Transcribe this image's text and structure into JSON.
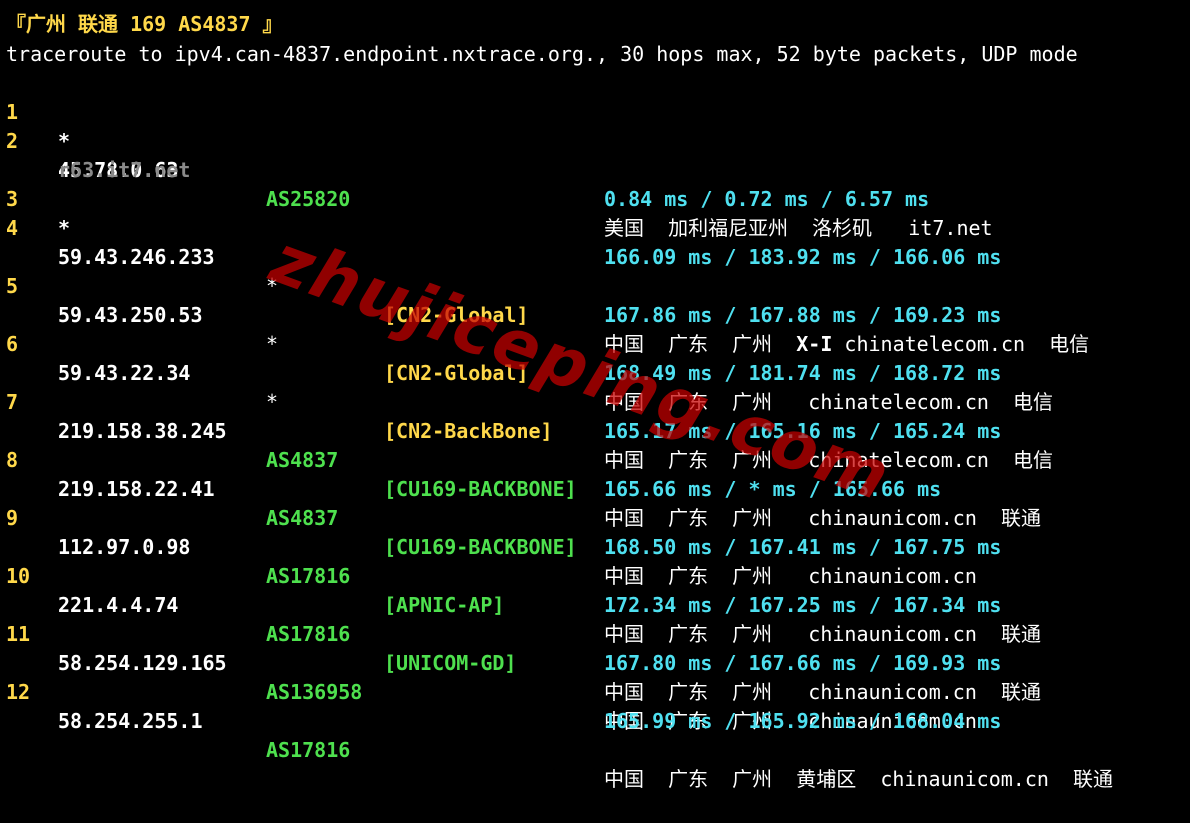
{
  "title": "『广州 联通 169 AS4837 』",
  "header": "traceroute to ipv4.can-4837.endpoint.nxtrace.org., 30 hops max, 52 byte packets, UDP mode",
  "watermark": "zhujiceping.com",
  "colors": {
    "background": "#000000",
    "hop_number": "#ffd84a",
    "asn": "#4ee04e",
    "rtt": "#4fe0f0",
    "rdns": "#8a8a8a",
    "watermark": "#c80000"
  },
  "hops": [
    {
      "n": "1",
      "ip": "*"
    },
    {
      "n": "2",
      "ip": "45.78.0.63",
      "asn": "AS25820",
      "tag": "",
      "geo": "美国  加利福尼亚州  洛杉矶   it7.net",
      "rdns": "r63.it7.net",
      "rtt": "0.84 ms / 0.72 ms / 6.57 ms"
    },
    {
      "n": "3",
      "ip": "*"
    },
    {
      "n": "4",
      "ip": "59.43.246.233",
      "asn": "*",
      "tag": "[CN2-Global]",
      "geo": "中国  广东  广州  ",
      "geo_bold": "X-I",
      "geo_tail": " chinatelecom.cn  电信",
      "rtt": "166.09 ms / 183.92 ms / 166.06 ms"
    },
    {
      "n": "5",
      "ip": "59.43.250.53",
      "asn": "*",
      "tag": "[CN2-Global]",
      "geo": "中国  广东  广州   chinatelecom.cn  电信",
      "rtt": "167.86 ms / 167.88 ms / 169.23 ms"
    },
    {
      "n": "6",
      "ip": "59.43.22.34",
      "asn": "*",
      "tag": "[CN2-BackBone]",
      "geo": "中国  广东  广州   chinatelecom.cn  电信",
      "rtt": "168.49 ms / 181.74 ms / 168.72 ms"
    },
    {
      "n": "7",
      "ip": "219.158.38.245",
      "asn": "AS4837",
      "tag": "[CU169-BACKBONE]",
      "geo": "中国  广东  广州   chinaunicom.cn  联通",
      "rtt": "165.17 ms / 165.16 ms / 165.24 ms"
    },
    {
      "n": "8",
      "ip": "219.158.22.41",
      "asn": "AS4837",
      "tag": "[CU169-BACKBONE]",
      "geo": "中国  广东  广州   chinaunicom.cn",
      "rtt": "165.66 ms / * ms / 165.66 ms"
    },
    {
      "n": "9",
      "ip": "112.97.0.98",
      "asn": "AS17816",
      "tag": "[APNIC-AP]",
      "geo": "中国  广东  广州   chinaunicom.cn  联通",
      "rtt": "168.50 ms / 167.41 ms / 167.75 ms"
    },
    {
      "n": "10",
      "ip": "221.4.4.74",
      "asn": "AS17816",
      "tag": "[UNICOM-GD]",
      "geo": "中国  广东  广州   chinaunicom.cn  联通",
      "rtt": "172.34 ms / 167.25 ms / 167.34 ms"
    },
    {
      "n": "11",
      "ip": "58.254.129.165",
      "asn": "AS136958",
      "tag": "",
      "geo": "中国  广东  广州   chinaunicom.cn",
      "rtt": "167.80 ms / 167.66 ms / 169.93 ms"
    },
    {
      "n": "12",
      "ip": "58.254.255.1",
      "asn": "AS17816",
      "tag": "",
      "geo": "中国  广东  广州  黄埔区  chinaunicom.cn  联通",
      "rtt": "165.99 ms / 165.92 ms / 168.04 ms"
    }
  ]
}
